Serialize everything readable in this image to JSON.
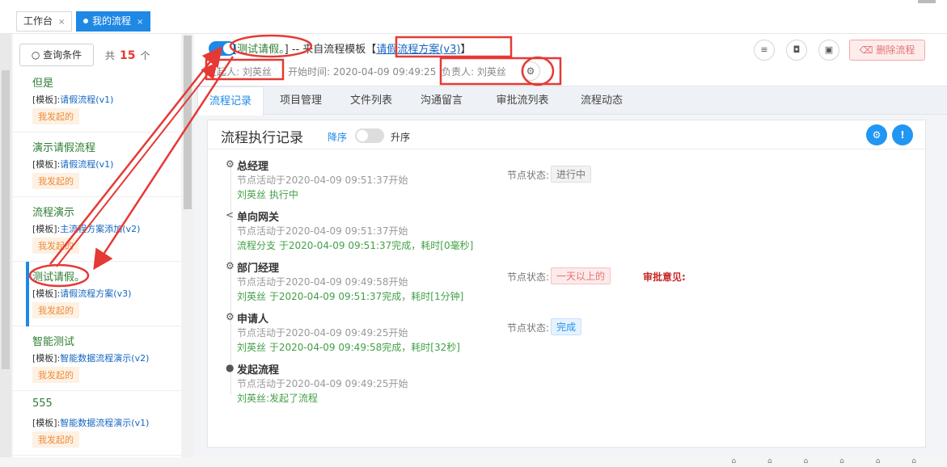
{
  "tabs": [
    {
      "label": "工作台",
      "close": "×"
    },
    {
      "label": "我的流程",
      "close": "×"
    }
  ],
  "sidebar": {
    "query_label": "查询条件",
    "count_prefix": "共",
    "count": "15",
    "count_suffix": "个",
    "items": [
      {
        "name": "但是",
        "tpl_prefix": "[模板]:",
        "tpl": "请假流程(v1)",
        "badge": "我发起的"
      },
      {
        "name": "演示请假流程",
        "tpl_prefix": "[模板]:",
        "tpl": "请假流程(v1)",
        "badge": "我发起的"
      },
      {
        "name": "流程演示",
        "tpl_prefix": "[模板]:",
        "tpl": "主流程方案添加(v2)",
        "badge": "我发起的"
      },
      {
        "name": "测试请假。",
        "tpl_prefix": "[模板]:",
        "tpl": "请假流程方案(v3)",
        "badge": "我发起的"
      },
      {
        "name": "智能测试",
        "tpl_prefix": "[模板]:",
        "tpl": "智能数据流程演示(v2)",
        "badge": "我发起的"
      },
      {
        "name": "555",
        "tpl_prefix": "[模板]:",
        "tpl": "智能数据流程演示(v1)",
        "badge": "我发起的"
      }
    ]
  },
  "header": {
    "title_open": "[",
    "title_name": "测试请假。",
    "title_mid": "] -- 来自流程模板【",
    "template_link": "请假流程方案(v3)",
    "title_close": "】",
    "initiator_label": "发起人:",
    "initiator": "刘英丝",
    "start_label": "开始时间:",
    "start_time": "2020-04-09 09:49:25",
    "owner_label": "负责人:",
    "owner": "刘英丝",
    "delete_label": "删除流程"
  },
  "nav_tabs": [
    "流程记录",
    "项目管理",
    "文件列表",
    "沟通留言",
    "审批流列表",
    "流程动态"
  ],
  "record": {
    "title": "流程执行记录",
    "desc_label": "降序",
    "asc_label": "升序",
    "status_label": "节点状态:",
    "opinion_label": "审批意见:",
    "nodes": [
      {
        "icon": "gear-icon",
        "name": "总经理",
        "activity": "节点活动于2020-04-09 09:51:37开始",
        "result": "刘英丝 执行中",
        "status": "进行中",
        "status_type": "running"
      },
      {
        "icon": "share-icon",
        "name": "单向网关",
        "activity": "节点活动于2020-04-09 09:51:37开始",
        "result": "流程分支 于2020-04-09 09:51:37完成，耗时[0毫秒]",
        "status": "",
        "status_type": ""
      },
      {
        "icon": "gear-icon",
        "name": "部门经理",
        "activity": "节点活动于2020-04-09 09:49:58开始",
        "result": "刘英丝 于2020-04-09 09:51:37完成，耗时[1分钟]",
        "status": "一天以上的",
        "status_type": "overdue"
      },
      {
        "icon": "gear-icon",
        "name": "申请人",
        "activity": "节点活动于2020-04-09 09:49:25开始",
        "result": "刘英丝 于2020-04-09 09:49:58完成，耗时[32秒]",
        "status": "完成",
        "status_type": "done"
      },
      {
        "icon": "map-pin-icon",
        "name": "发起流程",
        "activity": "节点活动于2020-04-09 09:49:25开始",
        "result": "刘英丝:发起了流程",
        "status": "",
        "status_type": ""
      }
    ]
  },
  "colors": {
    "accent": "#1e88e5",
    "annotation": "#e53935",
    "success": "#43a047"
  }
}
